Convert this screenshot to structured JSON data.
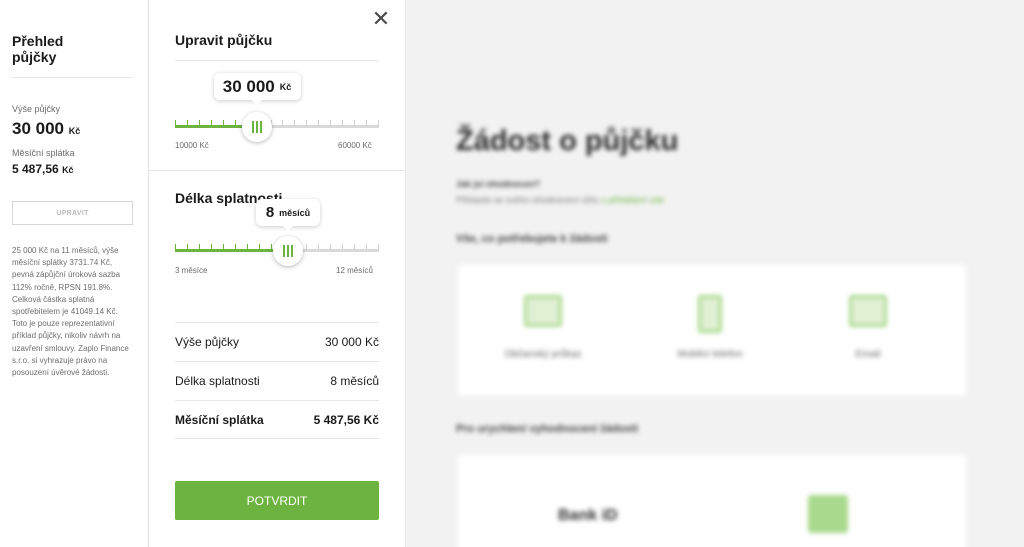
{
  "summary": {
    "title": "Přehled půjčky",
    "loan_amount_label": "Výše půjčky",
    "loan_amount_value": "30 000",
    "currency": "Kč",
    "monthly_payment_label": "Měsíční splátka",
    "monthly_payment_value": "5 487,56",
    "edit_button": "UPRAVIT",
    "disclaimer": "25 000 Kč na 11 měsíců, výše měsíční splátky 3731.74 Kč, pevná zápůjční úroková sazba 112% ročně, RPSN 191.8%. Celková částka splatná spotřebitelem je 41049.14 Kč. Toto je pouze reprezentativní příklad půjčky, nikoliv návrh na uzavření smlouvy. Zaplo Finance s.r.o. si vyhrazuje právo na posouzení úvěrové žádosti."
  },
  "editor": {
    "close_icon": "close-icon",
    "title": "Upravit půjčku",
    "amount_slider": {
      "value": "30 000",
      "unit": "Kč",
      "min_label": "10000 Kč",
      "max_label": "60000 Kč",
      "min": 10000,
      "max": 60000,
      "current": 30000
    },
    "term_title": "Délka splatnosti",
    "term_slider": {
      "value": "8",
      "unit": "měsíců",
      "min_label": "3 měsíce",
      "max_label": "12 měsíců",
      "min": 3,
      "max": 12,
      "current": 8
    },
    "rows": [
      {
        "label": "Výše půjčky",
        "value": "30 000 Kč"
      },
      {
        "label": "Délka splatnosti",
        "value": "8 měsíců"
      },
      {
        "label": "Měsíční splátka",
        "value": "5 487,56 Kč"
      }
    ],
    "confirm_button": "POTVRDIT"
  },
  "background": {
    "title": "Žádost o půjčku",
    "question": "Jak jsi ohodnocen?",
    "subtitle": "Přihlaste se svého ohodnocení účtu",
    "subtitle_link": "s přihlášení zde",
    "section1": "Vše, co potřebujete k žádosti",
    "options": [
      "Občanský průkaz",
      "Mobilní telefon",
      "Email"
    ],
    "section2": "Pro urychlení vyhodnocení žádosti",
    "bank": "Bank iD"
  },
  "colors": {
    "accent": "#6cb33f",
    "track": "#d9d9d9",
    "text": "#1a1a1a"
  }
}
